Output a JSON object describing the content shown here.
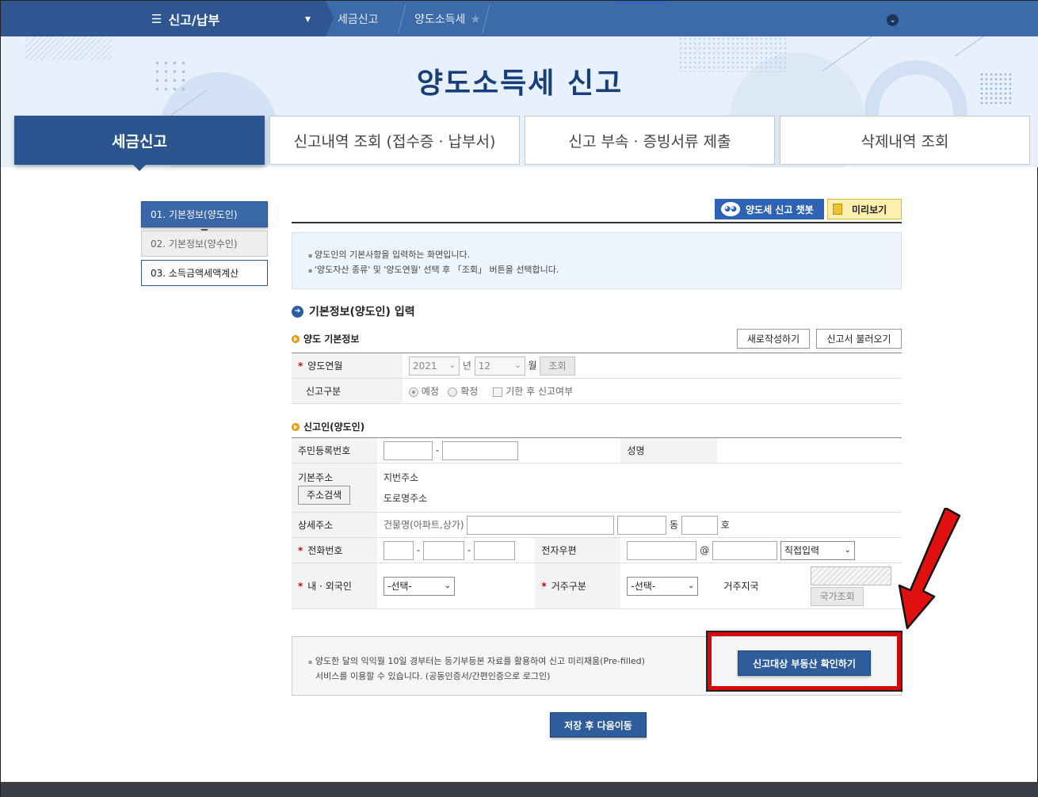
{
  "topbar": {
    "menu_label": "신고/납부",
    "breadcrumbs": [
      "세금신고",
      "양도소득세"
    ]
  },
  "page": {
    "title": "양도소득세 신고"
  },
  "tabs": [
    {
      "label": "세금신고",
      "active": true
    },
    {
      "label": "신고내역 조회 (접수증 · 납부서)",
      "active": false
    },
    {
      "label": "신고 부속 · 증빙서류 제출",
      "active": false
    },
    {
      "label": "삭제내역 조회",
      "active": false
    }
  ],
  "steps": [
    {
      "label": "01. 기본정보(양도인)",
      "state": "active"
    },
    {
      "label": "02. 기본정보(양수인)",
      "state": "disabled"
    },
    {
      "label": "03. 소득금액세액계산",
      "state": "current"
    }
  ],
  "toolbar": {
    "chatbot_label": "양도세 신고 챗봇",
    "preview_label": "미리보기"
  },
  "notice": [
    "양도인의 기본사항을 입력하는 화면입니다.",
    "'양도자산 종류' 및 '양도연월' 선택 후 「조회」 버튼을 선택합니다."
  ],
  "section": {
    "title": "기본정보(양도인) 입력",
    "sub1": "양도 기본정보",
    "sub2": "신고인(양도인)",
    "new_button": "새로작성하기",
    "load_button": "신고서 불러오기"
  },
  "basic": {
    "period_label": "양도연월",
    "year": "2021",
    "year_unit": "년",
    "month": "12",
    "month_unit": "월",
    "lookup_button": "조회",
    "type_label": "신고구분",
    "opt_scheduled": "예정",
    "opt_final": "확정",
    "opt_late": "기한 후 신고여부"
  },
  "reporter": {
    "rrn_label": "주민등록번호",
    "name_label": "성명",
    "address_label": "기본주소",
    "address_search": "주소검색",
    "lot_address": "지번주소",
    "road_address": "도로명주소",
    "detail_label": "상세주소",
    "building_label": "건물명(아파트,상가)",
    "dong": "동",
    "ho": "호",
    "phone_label": "전화번호",
    "email_label": "전자우편",
    "email_at": "@",
    "email_domain": "직접입력",
    "national_label": "내 · 외국인",
    "national_value": "-선택-",
    "residence_label": "거주구분",
    "residence_value": "-선택-",
    "country_label": "거주지국",
    "country_button": "국가조회",
    "dash": "-"
  },
  "prefill": {
    "text_line1": "양도한 달의 익익월 10일 경부터는 등기부등본 자료를 활용하여 신고 미리채움(Pre-filled)",
    "text_line2": "서비스를 이용할 수 있습니다. (공동인증서/간편인증으로 로그인)",
    "check_button": "신고대상 부동산 확인하기"
  },
  "save_button": "저장 후 다음이동",
  "colors": {
    "primary": "#2f5c9b",
    "highlight": "#d30a0a",
    "title": "#17407a"
  }
}
